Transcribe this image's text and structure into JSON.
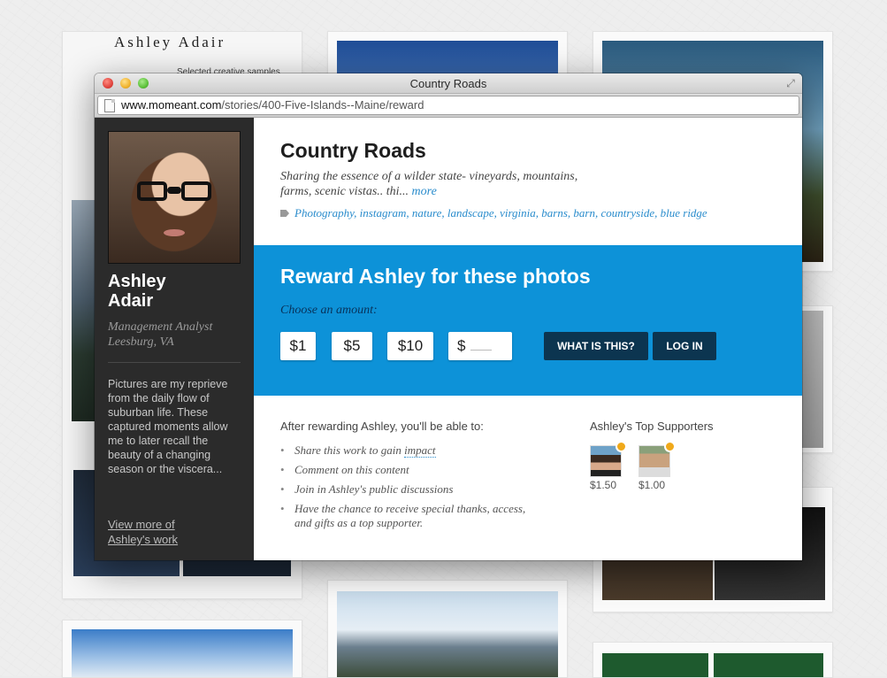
{
  "background": {
    "profile_name": "Ashley Adair",
    "profile_sub": "Selected creative samples"
  },
  "window": {
    "title": "Country Roads",
    "url_host": "www.momeant.com",
    "url_path": "/stories/400-Five-Islands--Maine/reward"
  },
  "sidebar": {
    "name_first": "Ashley",
    "name_last": "Adair",
    "role": "Management Analyst",
    "location": "Leesburg, VA",
    "bio": "Pictures are my reprieve from the daily flow of suburban life. These captured moments allow me to later recall the beauty of a changing season or the viscera...",
    "link_line1": "View more of",
    "link_line2": "Ashley's work"
  },
  "story": {
    "title": "Country Roads",
    "description": "Sharing the essence of a wilder state- vineyards, mountains, farms, scenic vistas.. thi...",
    "more_label": "more",
    "tags": [
      "Photography",
      "instagram",
      "nature",
      "landscape",
      "virginia",
      "barns",
      "barn",
      "countryside",
      "blue ridge"
    ]
  },
  "reward": {
    "title": "Reward Ashley for these photos",
    "choose_label": "Choose an amount:",
    "amounts": [
      "$1",
      "$5",
      "$10"
    ],
    "custom_prefix": "$",
    "what_is_this": "WHAT IS THIS?",
    "log_in": "LOG IN"
  },
  "benefits": {
    "title": "After rewarding Ashley, you'll be able to:",
    "items": [
      "Share this work to gain",
      "Comment on this content",
      "Join in Ashley's public discussions",
      "Have the chance to receive special thanks, access, and gifts as a top supporter."
    ],
    "impact_label": "impact"
  },
  "supporters": {
    "title": "Ashley's Top Supporters",
    "list": [
      {
        "amount": "$1.50"
      },
      {
        "amount": "$1.00"
      }
    ]
  },
  "colors": {
    "reward_blue": "#0d92d8",
    "dark_button": "#0c3550",
    "link_blue": "#2a8ccc",
    "sidebar_bg": "#2b2b2b"
  }
}
